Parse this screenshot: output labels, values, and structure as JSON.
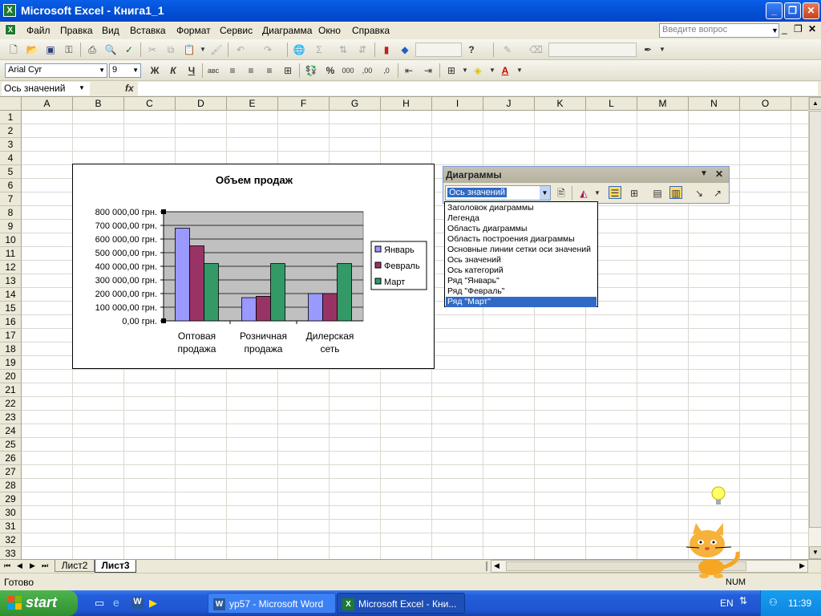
{
  "window": {
    "title": "Microsoft Excel - Книга1_1",
    "app_icon": "excel-icon"
  },
  "menu": {
    "items": [
      "Файл",
      "Правка",
      "Вид",
      "Вставка",
      "Формат",
      "Сервис",
      "Диаграмма",
      "Окно",
      "Справка"
    ],
    "ask_placeholder": "Введите вопрос"
  },
  "formatting": {
    "font": "Arial Cyr",
    "size": "9",
    "bold": "Ж",
    "italic": "К",
    "underline": "Ч",
    "percent": "%",
    "thousands": "000"
  },
  "formula_bar": {
    "name_box": "Ось значений",
    "fx": "fx",
    "value": ""
  },
  "columns": [
    "A",
    "B",
    "C",
    "D",
    "E",
    "F",
    "G",
    "H",
    "I",
    "J",
    "K",
    "L",
    "M",
    "N",
    "O"
  ],
  "rows": [
    "1",
    "2",
    "3",
    "4",
    "5",
    "6",
    "7",
    "8",
    "9",
    "10",
    "11",
    "12",
    "13",
    "14",
    "15",
    "16",
    "17",
    "18",
    "19",
    "20",
    "21",
    "22",
    "23",
    "24",
    "25",
    "26",
    "27",
    "28",
    "29",
    "30",
    "31",
    "32",
    "33"
  ],
  "chart_data": {
    "type": "bar",
    "title": "Объем продаж",
    "categories": [
      "Оптовая продажа",
      "Розничная продажа",
      "Дилерская сеть"
    ],
    "category_lines": [
      [
        "Оптовая",
        "продажа"
      ],
      [
        "Розничная",
        "продажа"
      ],
      [
        "Дилерская",
        "сеть"
      ]
    ],
    "series": [
      {
        "name": "Январь",
        "values": [
          680000,
          170000,
          200000
        ],
        "color": "#9999ff"
      },
      {
        "name": "Февраль",
        "values": [
          550000,
          180000,
          200000
        ],
        "color": "#993366"
      },
      {
        "name": "Март",
        "values": [
          420000,
          420000,
          420000
        ],
        "color": "#339966"
      }
    ],
    "y_ticks": [
      "800 000,00 грн.",
      "700 000,00 грн.",
      "600 000,00 грн.",
      "500 000,00 грн.",
      "400 000,00 грн.",
      "300 000,00 грн.",
      "200 000,00 грн.",
      "100 000,00 грн.",
      "0,00 грн."
    ],
    "ylim": [
      0,
      800000
    ],
    "grid": true,
    "plot_area_color": "#c0c0c0",
    "legend": "right",
    "xlabel": "",
    "ylabel": ""
  },
  "chart_toolbar": {
    "title": "Диаграммы",
    "selected_object": "Ось значений",
    "objects": [
      "Заголовок диаграммы",
      "Легенда",
      "Область диаграммы",
      "Область построения диаграммы",
      "Основные линии сетки оси значений",
      "Ось значений",
      "Ось категорий",
      "Ряд \"Январь\"",
      "Ряд \"Февраль\"",
      "Ряд \"Март\""
    ],
    "highlighted": "Ряд \"Март\""
  },
  "sheet_tabs": [
    "Лист2",
    "Лист3"
  ],
  "active_sheet": "Лист3",
  "status": {
    "ready": "Готово",
    "num": "NUM"
  },
  "taskbar": {
    "start": "start",
    "tasks": [
      {
        "label": "yp57 - Microsoft Word",
        "icon": "word-icon"
      },
      {
        "label": "Microsoft Excel - Кни...",
        "icon": "excel-icon"
      }
    ],
    "lang": "EN",
    "clock": "11:39"
  },
  "colors": {
    "xp_blue": "#0453d8",
    "selection": "#316ac5"
  }
}
